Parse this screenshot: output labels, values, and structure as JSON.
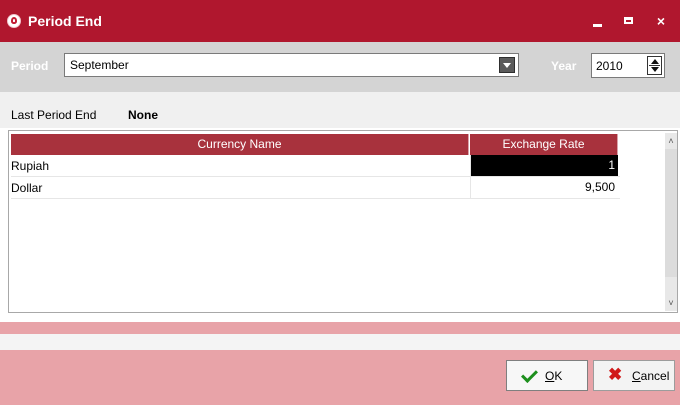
{
  "window": {
    "title": "Period End",
    "close_glyph": "×"
  },
  "period": {
    "label": "Period",
    "value": "September"
  },
  "year": {
    "label": "Year",
    "value": "2010"
  },
  "last_period_end": {
    "label": "Last Period End",
    "value": "None"
  },
  "grid": {
    "columns": [
      "Currency Name",
      "Exchange Rate"
    ],
    "rows": [
      {
        "name": "Rupiah",
        "rate": "1"
      },
      {
        "name": "Dollar",
        "rate": "9,500"
      }
    ],
    "scroll_up_glyph": "˄",
    "scroll_down_glyph": "˅"
  },
  "buttons": {
    "ok": {
      "mnemonic": "O",
      "rest": "K"
    },
    "cancel": {
      "mnemonic": "C",
      "rest": "ancel",
      "icon_glyph": "✖"
    }
  },
  "colors": {
    "titlebar": "#b0172e",
    "grid_header": "#a8323d",
    "footer": "#e8a3a8"
  }
}
